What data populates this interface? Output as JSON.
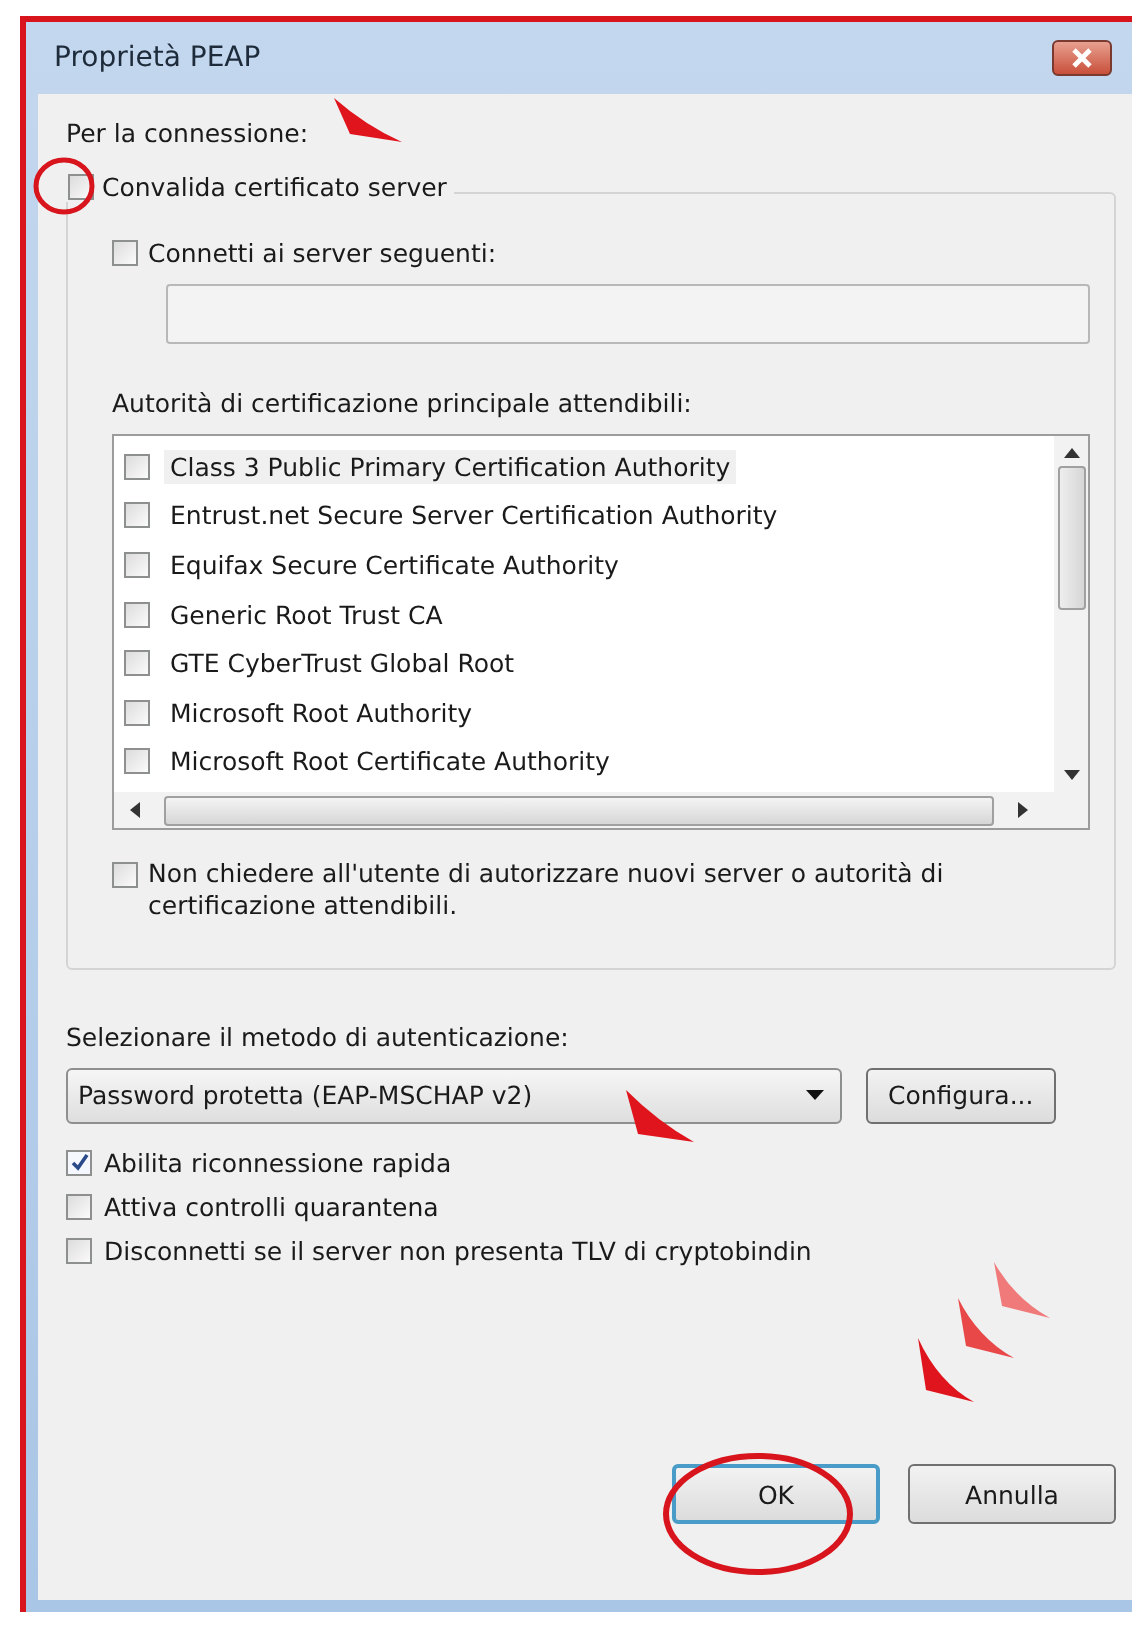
{
  "window": {
    "title": "Proprietà PEAP"
  },
  "connection_label": "Per la connessione:",
  "validate_certificate": {
    "label": "Convalida certificato server",
    "checked": false
  },
  "connect_servers": {
    "label": "Connetti ai server seguenti:",
    "checked": false
  },
  "trusted_ca_label": "Autorità di certificazione principale attendibili:",
  "ca_list": [
    {
      "label": "Class 3 Public Primary Certification Authority",
      "checked": false,
      "selected": true
    },
    {
      "label": "Entrust.net Secure Server Certification Authority",
      "checked": false,
      "selected": false
    },
    {
      "label": "Equifax Secure Certificate Authority",
      "checked": false,
      "selected": false
    },
    {
      "label": "Generic Root Trust CA",
      "checked": false,
      "selected": false
    },
    {
      "label": "GTE CyberTrust Global Root",
      "checked": false,
      "selected": false
    },
    {
      "label": "Microsoft Root Authority",
      "checked": false,
      "selected": false
    },
    {
      "label": "Microsoft Root Certificate Authority",
      "checked": false,
      "selected": false
    }
  ],
  "no_prompt": {
    "label": "Non chiedere all'utente di autorizzare nuovi server o autorità di certificazione attendibili.",
    "checked": false
  },
  "auth_method_label": "Selezionare il metodo di autenticazione:",
  "auth_method": {
    "value": "Password protetta (EAP-MSCHAP v2)"
  },
  "configure_button": "Configura...",
  "options": [
    {
      "label": "Abilita riconnessione rapida",
      "checked": true
    },
    {
      "label": "Attiva controlli quarantena",
      "checked": false
    },
    {
      "label": "Disconnetti se il server non presenta TLV di cryptobindin",
      "checked": false
    }
  ],
  "buttons": [
    {
      "label": "OK",
      "default": true
    },
    {
      "label": "Annulla",
      "default": false
    }
  ]
}
